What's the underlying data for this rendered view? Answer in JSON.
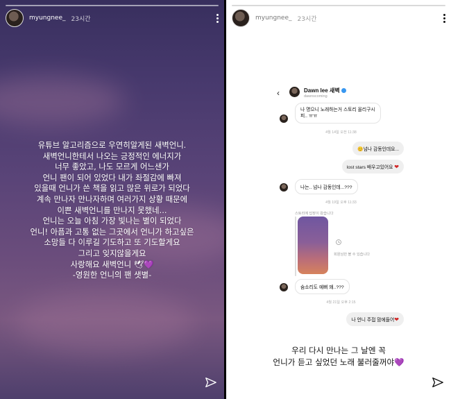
{
  "story1": {
    "username": "myungnee_",
    "time": "23시간",
    "lines": [
      "유튜브 알고리즘으로 우연히알게된 새벽언니.",
      "새벽언니한테서 나오는 긍정적인 에너지가",
      "너무 좋았고, 나도 모르게 어느샌가",
      "언니 팬이 되어 있었다 내가 좌절감에 빠져",
      "있을때 언니가 쓴 책을 읽고 많은 위로가 되었다",
      "계속 만나자 만나자하며 여러가지 상황 때문에",
      "이쁜 새벽언니를 만나지 못했네...",
      "언니는 오늘 아침 가장 빛나는 별이 되었다",
      "언니! 아픔과 고통 없는 그곳에서 언니가 하고싶은",
      "소망들 다 이루길 기도하고 또 기도할게요",
      "그리고 잊지않을게요",
      "사랑해요 새벽언니 🕊💜",
      "-영원한 언니의 팬 샛별-"
    ]
  },
  "story2": {
    "username": "myungnee_",
    "time": "23시간",
    "dm": {
      "name": "Dawn lee 새벽",
      "handle": "dawnscoming",
      "msg1_line1": "나 명으니 노래하는거 스토리 올리구시",
      "msg1_line2": "피.. ㅠㅠ",
      "ts1": "4월 14일 오전 11:38",
      "out1": "😊넘나 감동인데요...",
      "out2": "lost stars 배우고있어요",
      "msg2": "나는.. 넘나 감동인데...???",
      "ts2": "4월 19일 오후 11:33",
      "reply_label": "스토리에 답장이 왔습니다",
      "reply_note": "회원님만 볼 수 있습니다",
      "msg3": "숨소리도 예뻐 왜..???",
      "ts3": "4월 21일 오후 2:15",
      "out3": "나 언니 주접 맘에들어"
    },
    "caption_lines": [
      "우리 다시 만나는 그 날엔 꼭",
      "언니가 듣고 싶었던 노래 불러줄꺼야💜"
    ]
  }
}
